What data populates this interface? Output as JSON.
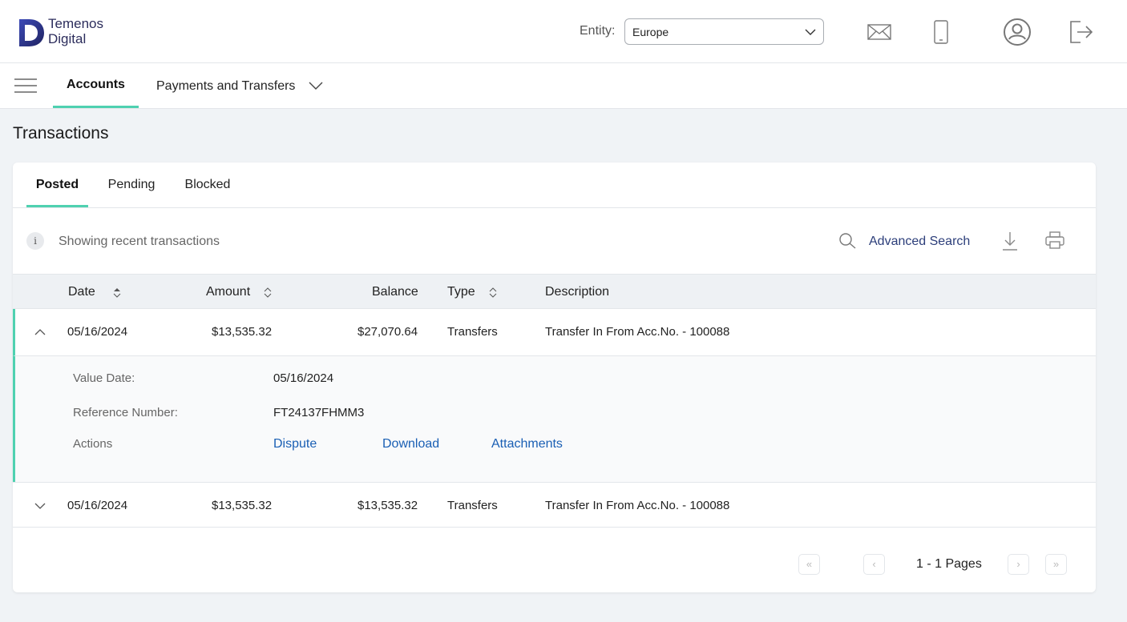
{
  "brand": {
    "line1": "Temenos",
    "line2": "Digital"
  },
  "header": {
    "entity_label": "Entity:",
    "entity_value": "Europe",
    "icons": [
      "mail-icon",
      "mobile-icon",
      "profile-icon",
      "logout-icon"
    ]
  },
  "nav": {
    "accounts": "Accounts",
    "payments": "Payments and Transfers"
  },
  "page_title": "Transactions",
  "tabs": [
    "Posted",
    "Pending",
    "Blocked"
  ],
  "info": {
    "text": "Showing recent transactions",
    "icon": "i",
    "advanced_search": "Advanced Search"
  },
  "table": {
    "headers": [
      "Date",
      "Amount",
      "Balance",
      "Type",
      "Description"
    ],
    "rows": [
      {
        "date": "05/16/2024",
        "amount": "$13,535.32",
        "balance": "$27,070.64",
        "type": "Transfers",
        "description": "Transfer In From Acc.No. - 100088"
      },
      {
        "date": "05/16/2024",
        "amount": "$13,535.32",
        "balance": "$13,535.32",
        "type": "Transfers",
        "description": "Transfer In From Acc.No. - 100088"
      }
    ]
  },
  "details": {
    "value_date_label": "Value Date:",
    "value_date": "05/16/2024",
    "reference_label": "Reference Number:",
    "reference": "FT24137FHMM3",
    "actions_label": "Actions",
    "actions": [
      "Dispute",
      "Download",
      "Attachments"
    ]
  },
  "pager": {
    "first": "«",
    "prev": "‹",
    "text": "1 - 1 Pages",
    "next": "›",
    "last": "»"
  },
  "colors": {
    "accent": "#4fd1b0",
    "link": "#1a5fb4",
    "brand": "#2c2d5c"
  }
}
